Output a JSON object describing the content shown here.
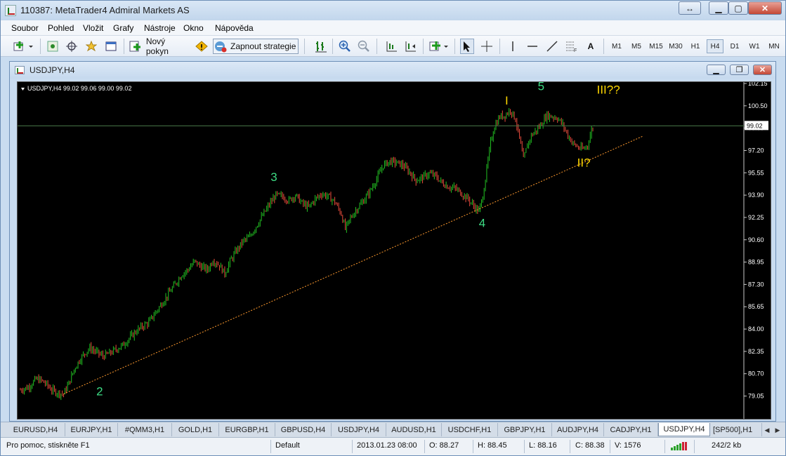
{
  "window": {
    "title": "110387: MetaTrader4 Admiral Markets AS"
  },
  "menu": [
    "Soubor",
    "Pohled",
    "Vložit",
    "Grafy",
    "Nástroje",
    "Okno",
    "Nápověda"
  ],
  "toolbar": {
    "new_order_label": "Nový pokyn",
    "strategy_label": "Zapnout strategie",
    "text_tool": "A",
    "timeframes": [
      "M1",
      "M5",
      "M15",
      "M30",
      "H1",
      "H4",
      "D1",
      "W1",
      "MN"
    ],
    "active_timeframe": "H4"
  },
  "chart_window": {
    "title": "USDJPY,H4",
    "info_line": "USDJPY,H4  99.02 99.06 99.00 99.02",
    "current_price": "99.02"
  },
  "chart_data": {
    "type": "candlestick",
    "symbol": "USDJPY",
    "timeframe": "H4",
    "ohlc": {
      "open": 99.02,
      "high": 99.06,
      "low": 99.0,
      "close": 99.02
    },
    "ylim": [
      78.3,
      102.15
    ],
    "y_ticks": [
      "102.15",
      "100.50",
      "98.85",
      "97.20",
      "95.55",
      "93.90",
      "92.25",
      "90.60",
      "88.95",
      "87.30",
      "85.65",
      "84.00",
      "82.35",
      "80.70",
      "79.05"
    ],
    "price_path": [
      [
        0,
        79.5
      ],
      [
        6,
        79.7
      ],
      [
        12,
        80.3
      ],
      [
        16,
        80.2
      ],
      [
        20,
        79.9
      ],
      [
        24,
        79.5
      ],
      [
        28,
        79.3
      ],
      [
        33,
        79.2
      ],
      [
        37,
        80.0
      ],
      [
        41,
        81.0
      ],
      [
        45,
        81.7
      ],
      [
        49,
        82.2
      ],
      [
        53,
        82.6
      ],
      [
        58,
        82.3
      ],
      [
        63,
        82.0
      ],
      [
        68,
        82.2
      ],
      [
        73,
        82.5
      ],
      [
        78,
        82.8
      ],
      [
        83,
        83.3
      ],
      [
        88,
        83.8
      ],
      [
        93,
        84.2
      ],
      [
        98,
        84.5
      ],
      [
        103,
        85.2
      ],
      [
        108,
        85.9
      ],
      [
        113,
        86.6
      ],
      [
        118,
        87.3
      ],
      [
        123,
        88.0
      ],
      [
        128,
        88.4
      ],
      [
        133,
        89.0
      ],
      [
        138,
        88.6
      ],
      [
        143,
        88.4
      ],
      [
        147,
        89.1
      ],
      [
        152,
        88.7
      ],
      [
        156,
        88.1
      ],
      [
        160,
        89.0
      ],
      [
        165,
        89.8
      ],
      [
        170,
        90.5
      ],
      [
        175,
        90.8
      ],
      [
        180,
        91.6
      ],
      [
        185,
        92.4
      ],
      [
        190,
        93.2
      ],
      [
        195,
        93.9
      ],
      [
        200,
        93.8
      ],
      [
        205,
        93.5
      ],
      [
        210,
        93.9
      ],
      [
        215,
        93.3
      ],
      [
        220,
        93.0
      ],
      [
        225,
        93.6
      ],
      [
        230,
        94.0
      ],
      [
        235,
        93.8
      ],
      [
        240,
        93.4
      ],
      [
        245,
        92.5
      ],
      [
        248,
        91.4
      ],
      [
        252,
        92.2
      ],
      [
        257,
        92.9
      ],
      [
        262,
        93.5
      ],
      [
        267,
        94.2
      ],
      [
        272,
        95.1
      ],
      [
        277,
        96.1
      ],
      [
        282,
        96.4
      ],
      [
        287,
        96.3
      ],
      [
        292,
        96.1
      ],
      [
        297,
        95.6
      ],
      [
        302,
        95.0
      ],
      [
        307,
        95.2
      ],
      [
        312,
        95.5
      ],
      [
        317,
        95.3
      ],
      [
        322,
        94.8
      ],
      [
        327,
        94.5
      ],
      [
        332,
        94.4
      ],
      [
        337,
        94.0
      ],
      [
        342,
        93.6
      ],
      [
        346,
        93.1
      ],
      [
        350,
        92.7
      ],
      [
        353,
        93.8
      ],
      [
        356,
        95.8
      ],
      [
        359,
        97.8
      ],
      [
        362,
        99.0
      ],
      [
        366,
        99.7
      ],
      [
        370,
        99.8
      ],
      [
        374,
        100.2
      ],
      [
        378,
        99.5
      ],
      [
        381,
        98.1
      ],
      [
        384,
        96.5
      ],
      [
        387,
        97.6
      ],
      [
        390,
        98.3
      ],
      [
        394,
        98.7
      ],
      [
        398,
        99.2
      ],
      [
        402,
        99.8
      ],
      [
        406,
        99.7
      ],
      [
        410,
        99.6
      ],
      [
        414,
        99.1
      ],
      [
        418,
        98.3
      ],
      [
        422,
        97.7
      ],
      [
        426,
        97.4
      ],
      [
        430,
        97.3
      ],
      [
        433,
        97.6
      ],
      [
        436,
        98.7
      ],
      [
        438,
        99.02
      ]
    ],
    "trendline": {
      "style": "dotted",
      "color": "#ff9a2e",
      "from": {
        "i": 33,
        "price": 79.2
      },
      "to": {
        "i": 475,
        "price": 98.25
      }
    },
    "annotations": [
      {
        "text": "2",
        "i": 58,
        "price": 79.1,
        "color": "#3ddc84"
      },
      {
        "text": "3",
        "i": 191,
        "price": 94.95,
        "color": "#3ddc84"
      },
      {
        "text": "4",
        "i": 350,
        "price": 91.55,
        "color": "#3ddc84"
      },
      {
        "text": "5",
        "i": 395,
        "price": 101.65,
        "color": "#3ddc84"
      },
      {
        "text": "I",
        "i": 370,
        "price": 100.6,
        "color": "#ffd700"
      },
      {
        "text": "III??",
        "i": 440,
        "price": 101.4,
        "color": "#ffd700"
      },
      {
        "text": "II?",
        "i": 425,
        "price": 96.0,
        "color": "#ffd700"
      }
    ],
    "colors": {
      "background": "#000000",
      "bull": "#22c122",
      "bear": "#e84c3c",
      "grid": "#2a2a2a",
      "price_line": "#4a7a4a",
      "wave_green": "#3ddc84",
      "wave_yellow": "#ffd700"
    }
  },
  "tabs": [
    "EURUSD,H4",
    "EURJPY,H1",
    "#QMM3,H1",
    "GOLD,H1",
    "EURGBP,H1",
    "GBPUSD,H4",
    "USDJPY,H4",
    "AUDUSD,H1",
    "USDCHF,H1",
    "GBPJPY,H1",
    "AUDJPY,H4",
    "CADJPY,H1",
    "USDJPY,H4",
    "[SP500],H1"
  ],
  "active_tab": 12,
  "status": {
    "help": "Pro pomoc, stiskněte F1",
    "profile": "Default",
    "datetime": "2013.01.23 08:00",
    "open": "O: 88.27",
    "high": "H: 88.45",
    "low": "L: 88.16",
    "close": "C: 88.38",
    "volume": "V: 1576",
    "traffic": "242/2 kb"
  }
}
